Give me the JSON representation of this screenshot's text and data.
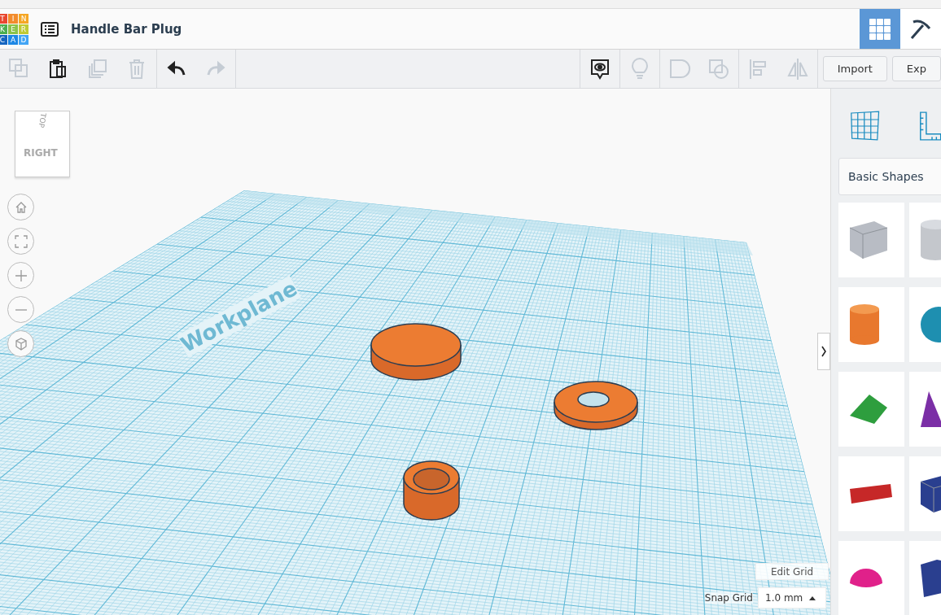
{
  "logo": {
    "letters": [
      "T",
      "I",
      "N",
      "K",
      "E",
      "R",
      "C",
      "A",
      "D"
    ]
  },
  "header": {
    "title": "Handle Bar Plug",
    "views": [
      {
        "kind": "grid",
        "selected": true
      },
      {
        "kind": "pickaxe",
        "selected": false
      }
    ]
  },
  "toolbar": {
    "left": [
      {
        "kind": "copy",
        "disabled": true
      },
      {
        "kind": "paste",
        "disabled": false
      },
      {
        "kind": "duplicate",
        "disabled": true
      },
      {
        "kind": "delete",
        "disabled": true
      },
      {
        "kind": "undo",
        "disabled": false
      },
      {
        "kind": "redo",
        "disabled": true
      }
    ],
    "right": [
      {
        "kind": "notes",
        "disabled": false
      },
      {
        "kind": "bulb",
        "disabled": true
      },
      {
        "kind": "solid",
        "disabled": true
      },
      {
        "kind": "hole",
        "disabled": true
      },
      {
        "kind": "align",
        "disabled": true
      },
      {
        "kind": "mirror",
        "disabled": true
      }
    ],
    "buttons": [
      "Import",
      "Exp"
    ]
  },
  "viewcube": {
    "front": "RIGHT",
    "top": "TOP"
  },
  "workplane": {
    "label": "Workplane"
  },
  "grid": {
    "edit": "Edit Grid",
    "snap_label": "Snap Grid",
    "snap_value": "1.0 mm"
  },
  "panel": {
    "category": "Basic Shapes",
    "shapes": [
      {
        "kind": "box-hole"
      },
      {
        "kind": "cylinder-hole"
      },
      {
        "kind": "cylinder"
      },
      {
        "kind": "sphere"
      },
      {
        "kind": "roof"
      },
      {
        "kind": "cone"
      },
      {
        "kind": "text"
      },
      {
        "kind": "box"
      },
      {
        "kind": "half-sphere"
      },
      {
        "kind": "prism"
      }
    ]
  }
}
